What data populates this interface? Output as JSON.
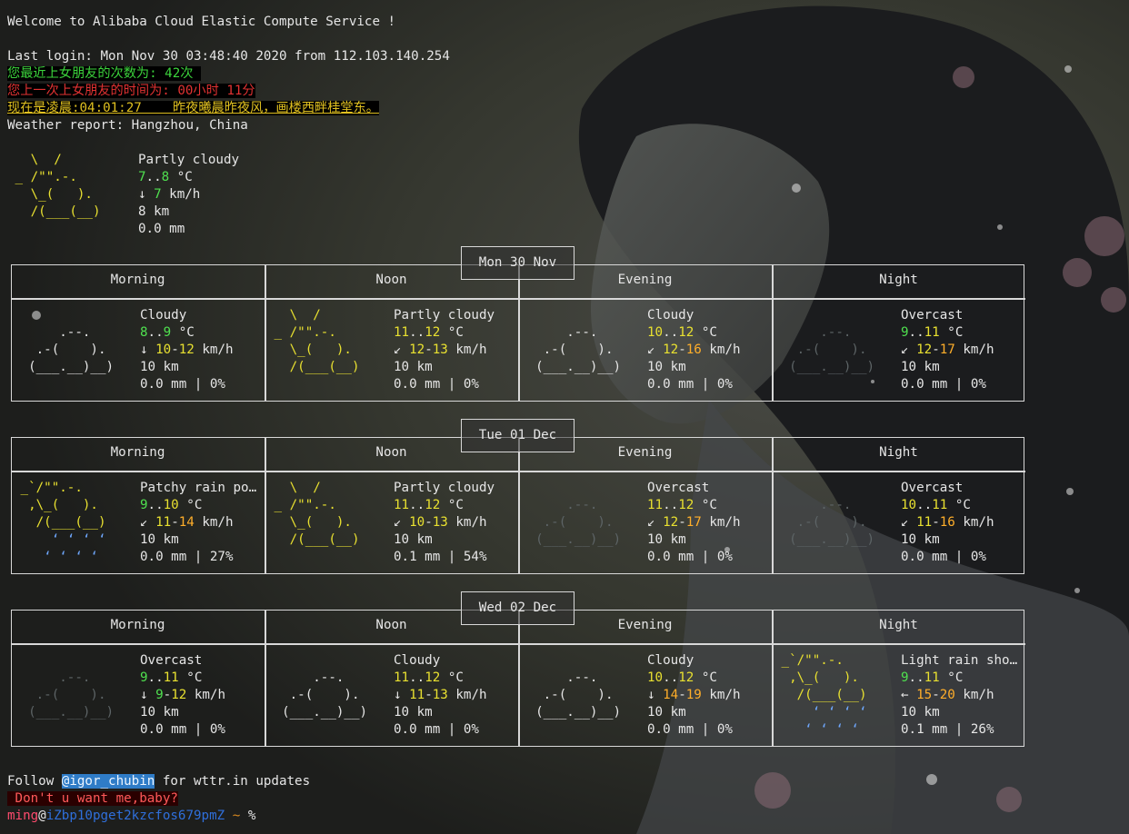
{
  "welcome": "Welcome to Alibaba Cloud Elastic Compute Service !",
  "last_login": "Last login: Mon Nov 30 03:48:40 2020 from 112.103.140.254",
  "msg1": "您最近上女朋友的次数为: 42次 ",
  "msg2": "您上一次上女朋友的时间为: 00小时 11分",
  "msg3": "现在是凌晨:04:01:27    昨夜曦晨昨夜风，画楼西畔桂堂东。",
  "weather_title": "Weather report: Hangzhou, China",
  "current": {
    "art": [
      "   \\  /",
      " _ /\"\".-.",
      "   \\_(   ).",
      "   /(___(__)",
      ""
    ],
    "condition": "Partly cloudy",
    "temp_low": "7",
    "temp_high": "8",
    "temp_unit": " °C",
    "wind_dir": "↓",
    "wind": "7",
    "wind_unit": " km/h",
    "visibility": "8 km",
    "precip": "0.0 mm"
  },
  "periods": [
    "Morning",
    "Noon",
    "Evening",
    "Night"
  ],
  "days": [
    {
      "date": "Mon 30 Nov",
      "cells": [
        {
          "art_type": "cloudy",
          "art": [
            "",
            "      .--.",
            "   .-(    ).",
            "  (___.__)__)",
            ""
          ],
          "condition": "Cloudy",
          "t1": "8",
          "t2": "9",
          "wd": "↓",
          "w1": "10",
          "w2": "12",
          "vis": "10 km",
          "precip": "0.0 mm | 0%"
        },
        {
          "art_type": "partly",
          "art": [
            "   \\  /",
            " _ /\"\".-.",
            "   \\_(   ).",
            "   /(___(__)",
            ""
          ],
          "condition": "Partly cloudy",
          "t1": "11",
          "t2": "12",
          "wd": "↙",
          "w1": "12",
          "w2": "13",
          "vis": "10 km",
          "precip": "0.0 mm | 0%"
        },
        {
          "art_type": "cloudy",
          "art": [
            "",
            "      .--.",
            "   .-(    ).",
            "  (___.__)__)",
            ""
          ],
          "condition": "Cloudy",
          "t1": "10",
          "t2": "12",
          "wd": "↙",
          "w1": "12",
          "w2": "16",
          "vis": "10 km",
          "precip": "0.0 mm | 0%"
        },
        {
          "art_type": "overcast",
          "art": [
            "",
            "      .--.",
            "   .-(    ).",
            "  (___.__)__)",
            ""
          ],
          "condition": "Overcast",
          "t1": "9",
          "t2": "11",
          "wd": "↙",
          "w1": "12",
          "w2": "17",
          "vis": "10 km",
          "precip": "0.0 mm | 0%"
        }
      ]
    },
    {
      "date": "Tue 01 Dec",
      "cells": [
        {
          "art_type": "rain",
          "art": [
            " _`/\"\".-.",
            "  ,\\_(   ).",
            "   /(___(__)",
            "     ʻ ʻ ʻ ʻ",
            "    ʻ ʻ ʻ ʻ"
          ],
          "condition": "Patchy rain po…",
          "t1": "9",
          "t2": "10",
          "wd": "↙",
          "w1": "11",
          "w2": "14",
          "vis": "10 km",
          "precip": "0.0 mm | 27%"
        },
        {
          "art_type": "partly",
          "art": [
            "   \\  /",
            " _ /\"\".-.",
            "   \\_(   ).",
            "   /(___(__)",
            ""
          ],
          "condition": "Partly cloudy",
          "t1": "11",
          "t2": "12",
          "wd": "↙",
          "w1": "10",
          "w2": "13",
          "vis": "10 km",
          "precip": "0.1 mm | 54%"
        },
        {
          "art_type": "overcast",
          "art": [
            "",
            "      .--.",
            "   .-(    ).",
            "  (___.__)__)",
            ""
          ],
          "condition": "Overcast",
          "t1": "11",
          "t2": "12",
          "wd": "↙",
          "w1": "12",
          "w2": "17",
          "vis": "10 km",
          "precip": "0.0 mm | 0%"
        },
        {
          "art_type": "overcast",
          "art": [
            "",
            "      .--.",
            "   .-(    ).",
            "  (___.__)__)",
            ""
          ],
          "condition": "Overcast",
          "t1": "10",
          "t2": "11",
          "wd": "↙",
          "w1": "11",
          "w2": "16",
          "vis": "10 km",
          "precip": "0.0 mm | 0%"
        }
      ]
    },
    {
      "date": "Wed 02 Dec",
      "cells": [
        {
          "art_type": "overcast",
          "art": [
            "",
            "      .--.",
            "   .-(    ).",
            "  (___.__)__)",
            ""
          ],
          "condition": "Overcast",
          "t1": "9",
          "t2": "11",
          "wd": "↓",
          "w1": "9",
          "w2": "12",
          "vis": "10 km",
          "precip": "0.0 mm | 0%"
        },
        {
          "art_type": "cloudy",
          "art": [
            "",
            "      .--.",
            "   .-(    ).",
            "  (___.__)__)",
            ""
          ],
          "condition": "Cloudy",
          "t1": "11",
          "t2": "12",
          "wd": "↓",
          "w1": "11",
          "w2": "13",
          "vis": "10 km",
          "precip": "0.0 mm | 0%"
        },
        {
          "art_type": "cloudy",
          "art": [
            "",
            "      .--.",
            "   .-(    ).",
            "  (___.__)__)",
            ""
          ],
          "condition": "Cloudy",
          "t1": "10",
          "t2": "12",
          "wd": "↓",
          "w1": "14",
          "w2": "19",
          "vis": "10 km",
          "precip": "0.0 mm | 0%"
        },
        {
          "art_type": "rain",
          "art": [
            " _`/\"\".-.",
            "  ,\\_(   ).",
            "   /(___(__)",
            "     ʻ ʻ ʻ ʻ",
            "    ʻ ʻ ʻ ʻ"
          ],
          "condition": "Light rain sho…",
          "t1": "9",
          "t2": "11",
          "wd": "←",
          "w1": "15",
          "w2": "20",
          "vis": "10 km",
          "precip": "0.1 mm | 26%"
        }
      ]
    }
  ],
  "follow": {
    "pre": "Follow ",
    "handle": "@igor_chubin",
    "post": " for wttr.in updates"
  },
  "baby": " Don't u want me,baby?",
  "prompt": {
    "user": "ming",
    "at": "@",
    "host": "iZbp10pget2kzcfos679pmZ",
    "path": " ~",
    "symbol": " %"
  },
  "colors": {
    "temp_green": "#4fe04f",
    "temp_yellow": "#e8e030",
    "wind_orange": "#ffae2a",
    "rain_blue": "#6fa8ff",
    "prompt_user": "#ff4b6e",
    "prompt_host": "#2f6fdb"
  }
}
